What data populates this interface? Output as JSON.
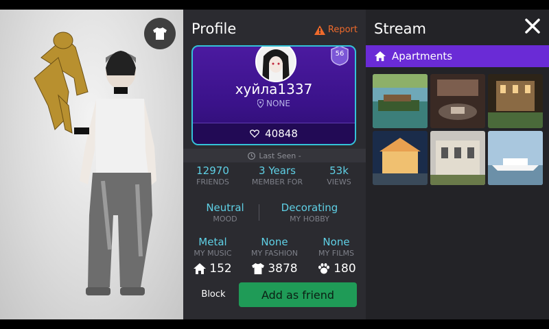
{
  "profile": {
    "title": "Profile",
    "report_label": "Report",
    "username": "хуйла1337",
    "location": "NONE",
    "level": "56",
    "likes": "40848",
    "last_seen": "Last Seen -",
    "stats_row1": [
      {
        "value": "12970",
        "label": "FRIENDS"
      },
      {
        "value": "3 Years",
        "label": "MEMBER FOR"
      },
      {
        "value": "53k",
        "label": "VIEWS"
      }
    ],
    "stats_row2": [
      {
        "value": "Neutral",
        "label": "MOOD"
      },
      {
        "value": "Decorating",
        "label": "MY HOBBY"
      }
    ],
    "stats_row3": [
      {
        "value": "Metal",
        "label": "MY MUSIC"
      },
      {
        "value": "None",
        "label": "MY FASHION"
      },
      {
        "value": "None",
        "label": "MY FILMS"
      }
    ],
    "counters": {
      "rooms": "152",
      "clothes": "3878",
      "pets": "180"
    },
    "block_label": "Block",
    "add_friend_label": "Add as friend"
  },
  "stream": {
    "title": "Stream",
    "category_label": "Apartments"
  },
  "colors": {
    "accent_cyan": "#5fd1e6",
    "card_purple": "#3a1289",
    "category_purple": "#6a2bd6",
    "add_green": "#1f9b57",
    "report_orange": "#ef6a2b"
  }
}
